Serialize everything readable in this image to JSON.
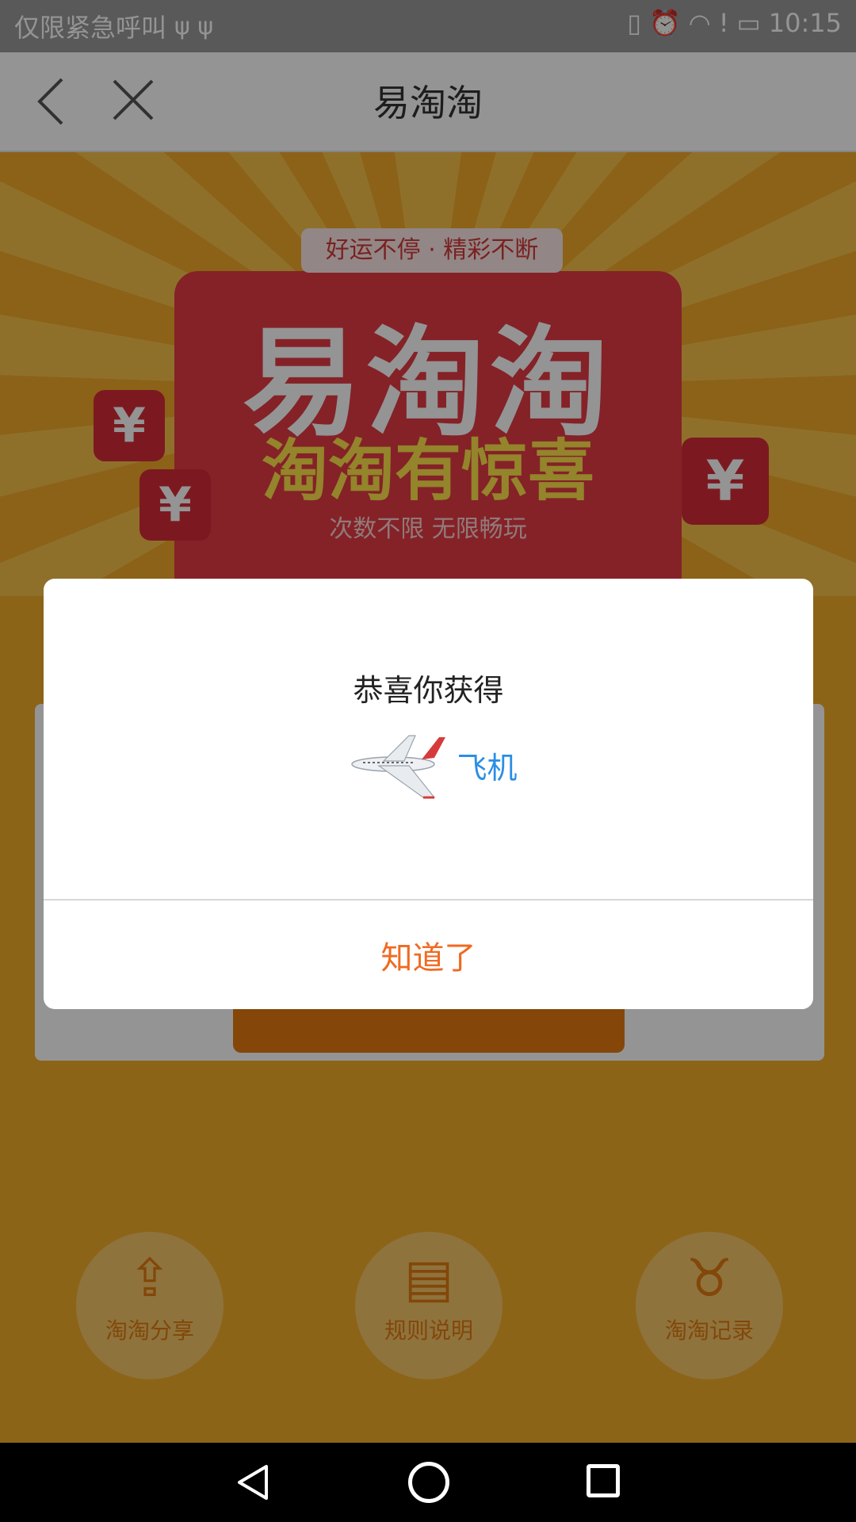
{
  "status_bar": {
    "left_text": "仅限紧急呼叫",
    "usb_symbols": "⚲ ⚲",
    "right_icons": [
      "vibrate-icon",
      "alarm-icon",
      "wifi-icon",
      "alert-icon",
      "battery-icon"
    ],
    "time": "10:15"
  },
  "header": {
    "title": "易淘淘"
  },
  "banner": {
    "tag": "好运不停 · 精彩不断",
    "title": "易淘淘",
    "subtitle": "淘淘有惊喜",
    "note": "次数不限  无限畅玩"
  },
  "bottom_actions": [
    {
      "label": "淘淘分享",
      "icon": "share-icon"
    },
    {
      "label": "规则说明",
      "icon": "document-icon"
    },
    {
      "label": "淘淘记录",
      "icon": "money-bag-icon"
    }
  ],
  "dialog": {
    "title": "恭喜你获得",
    "prize_name": "飞机",
    "prize_icon": "airplane-icon",
    "confirm_label": "知道了"
  },
  "colors": {
    "accent_orange": "#f06a22",
    "link_blue": "#2b8ee6",
    "page_bg": "#f2ad2a"
  }
}
